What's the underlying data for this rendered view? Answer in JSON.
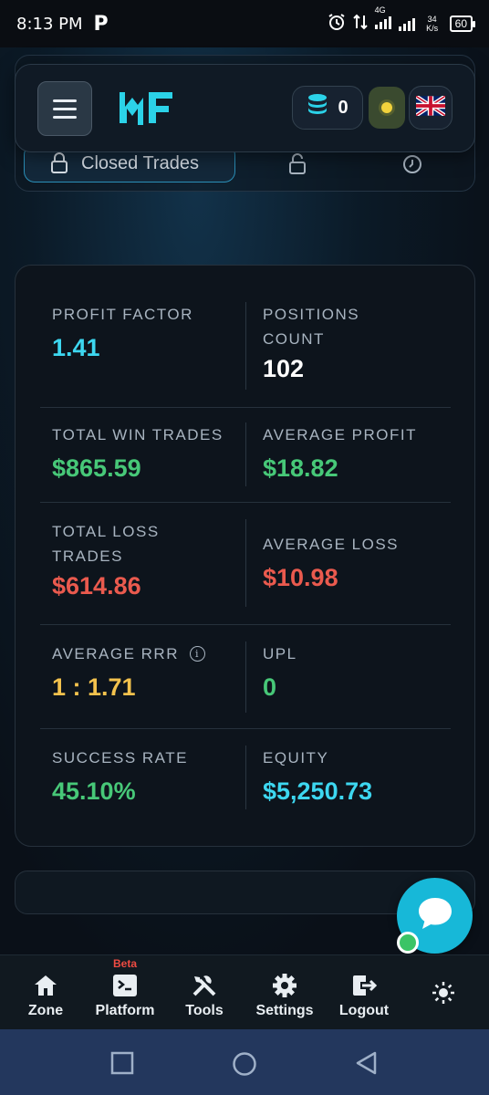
{
  "status_bar": {
    "time": "8:13 PM",
    "app_icon": "P",
    "network_speed": "34 K/s",
    "network_type": "4G",
    "battery": "60"
  },
  "header": {
    "logo_text": "RF",
    "coins_count": "0",
    "language_flag": "uk-flag-icon"
  },
  "tabs": {
    "active_label": "Closed Trades"
  },
  "stats": {
    "profit_factor": {
      "label": "PROFIT FACTOR",
      "value": "1.41"
    },
    "positions_count": {
      "label_line1": "POSITIONS",
      "label_line2": "COUNT",
      "value": "102"
    },
    "total_win_trades": {
      "label": "TOTAL WIN TRADES",
      "value": "$865.59"
    },
    "average_profit": {
      "label": "AVERAGE PROFIT",
      "value": "$18.82"
    },
    "total_loss_trades": {
      "label_line1": "TOTAL LOSS",
      "label_line2": "TRADES",
      "value": "$614.86"
    },
    "average_loss": {
      "label": "AVERAGE LOSS",
      "value": "$10.98"
    },
    "average_rrr": {
      "label": "AVERAGE RRR",
      "value": "1 : 1.71"
    },
    "upl": {
      "label": "UPL",
      "value": "0"
    },
    "success_rate": {
      "label": "SUCCESS RATE",
      "value": "45.10%"
    },
    "equity": {
      "label": "EQUITY",
      "value": "$5,250.73"
    }
  },
  "bottom_nav": {
    "zone": "Zone",
    "platform": "Platform",
    "platform_badge": "Beta",
    "tools": "Tools",
    "settings": "Settings",
    "logout": "Logout"
  },
  "colors": {
    "accent_cyan": "#3dd7f0",
    "positive_green": "#47c878",
    "negative_red": "#ea5a4e",
    "warning_yellow": "#f3c24d"
  }
}
